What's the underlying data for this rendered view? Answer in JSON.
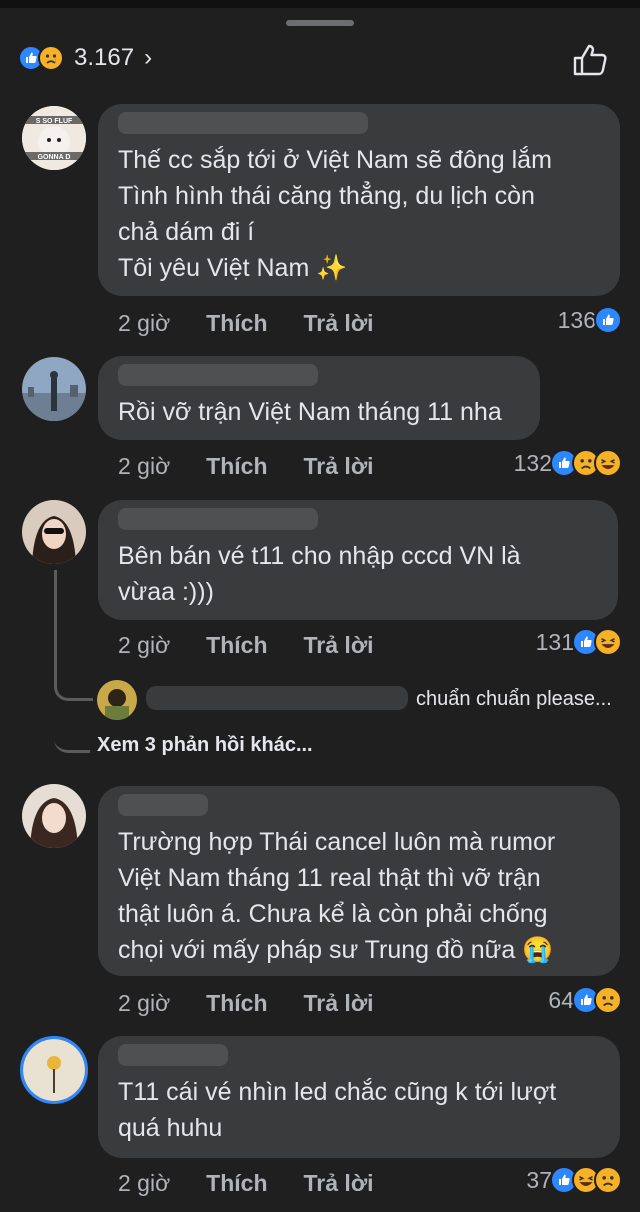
{
  "header": {
    "reaction_count": "3.167",
    "chevron": "›",
    "icons": [
      "like-icon",
      "sad-icon",
      "chevron-right-icon",
      "thumbs-up-outline-icon"
    ]
  },
  "comments": [
    {
      "text": "Thế cc sắp tới ở Việt Nam sẽ đông lắm\nTình hình thái căng thẳng, du lịch còn\nchả dám đi í\nTôi yêu Việt Nam ✨",
      "time": "2 giờ",
      "like": "Thích",
      "reply": "Trả lời",
      "reaction_count": "136",
      "reactions": [
        "like"
      ]
    },
    {
      "text": "Rồi vỡ trận Việt Nam tháng 11 nha",
      "time": "2 giờ",
      "like": "Thích",
      "reply": "Trả lời",
      "reaction_count": "132",
      "reactions": [
        "like",
        "sad",
        "haha"
      ]
    },
    {
      "text": "Bên bán vé t11 cho nhập cccd VN là\nvừaa :)))",
      "time": "2 giờ",
      "like": "Thích",
      "reply": "Trả lời",
      "reaction_count": "131",
      "reactions": [
        "like",
        "haha"
      ],
      "reply_preview": "chuẩn chuẩn please...",
      "more_replies": "Xem 3 phản hồi khác..."
    },
    {
      "text": "Trường hợp Thái cancel luôn mà rumor\nViệt Nam tháng 11 real thật thì vỡ trận\nthật luôn á. Chưa kể là còn phải chống\nchọi với mấy pháp sư Trung đồ nữa 😭",
      "time": "2 giờ",
      "like": "Thích",
      "reply": "Trả lời",
      "reaction_count": "64",
      "reactions": [
        "like",
        "sad"
      ]
    },
    {
      "text": "T11 cái vé nhìn led chắc cũng k tới lượt\nquá huhu",
      "time": "2 giờ",
      "like": "Thích",
      "reply": "Trả lời",
      "reaction_count": "37",
      "reactions": [
        "like",
        "haha",
        "sad"
      ]
    }
  ],
  "avatar1_text": [
    "S SO FLUF",
    "GONNA D"
  ],
  "colors": {
    "background": "#1f1f20",
    "bubble": "#3a3b3c",
    "like_blue": "#2d88ff",
    "emoji_yellow": "#f7b125",
    "muted": "#b0b3b8"
  }
}
